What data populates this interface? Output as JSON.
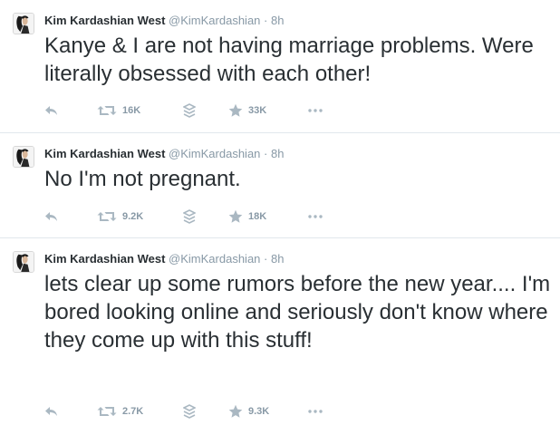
{
  "tweets": [
    {
      "name": "Kim Kardashian West",
      "handle": "@KimKardashian",
      "separator": "·",
      "time": "8h",
      "text": "Kanye & I are not having marriage problems. Were literally obsessed with each other!",
      "retweets": "16K",
      "favorites": "33K"
    },
    {
      "name": "Kim Kardashian West",
      "handle": "@KimKardashian",
      "separator": "·",
      "time": "8h",
      "text": "No I'm not pregnant.",
      "retweets": "9.2K",
      "favorites": "18K"
    },
    {
      "name": "Kim Kardashian West",
      "handle": "@KimKardashian",
      "separator": "·",
      "time": "8h",
      "text": "lets clear up some rumors before the new year.... I'm bored looking online and seriously don't know where they come up with this stuff!",
      "retweets": "2.7K",
      "favorites": "9.3K"
    }
  ],
  "icons": {
    "reply": "reply-icon",
    "retweet": "retweet-icon",
    "stack": "stack-icon",
    "favorite": "star-icon",
    "more": "more-icon"
  },
  "colors": {
    "text": "#292f33",
    "muted": "#8899a6",
    "icon": "#aab8c2",
    "divider": "#e1e8ed"
  }
}
